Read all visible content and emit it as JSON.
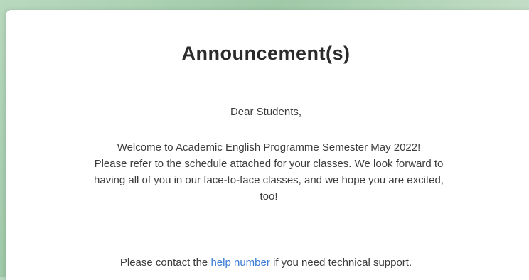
{
  "announcement": {
    "title": "Announcement(s)",
    "greeting": "Dear Students,",
    "lines": [
      "Welcome to Academic English Programme Semester May 2022!",
      "Please refer to the schedule attached for your classes. We look forward to",
      "having all of you in our face-to-face classes, and we hope you are excited,",
      "too!"
    ],
    "support_prefix": "Please contact the",
    "support_link": "help number",
    "support_suffix": "if you need technical support."
  },
  "colors": {
    "background": "#a9cfb0",
    "link": "#3a7bd5",
    "text": "#3c3c3c"
  }
}
